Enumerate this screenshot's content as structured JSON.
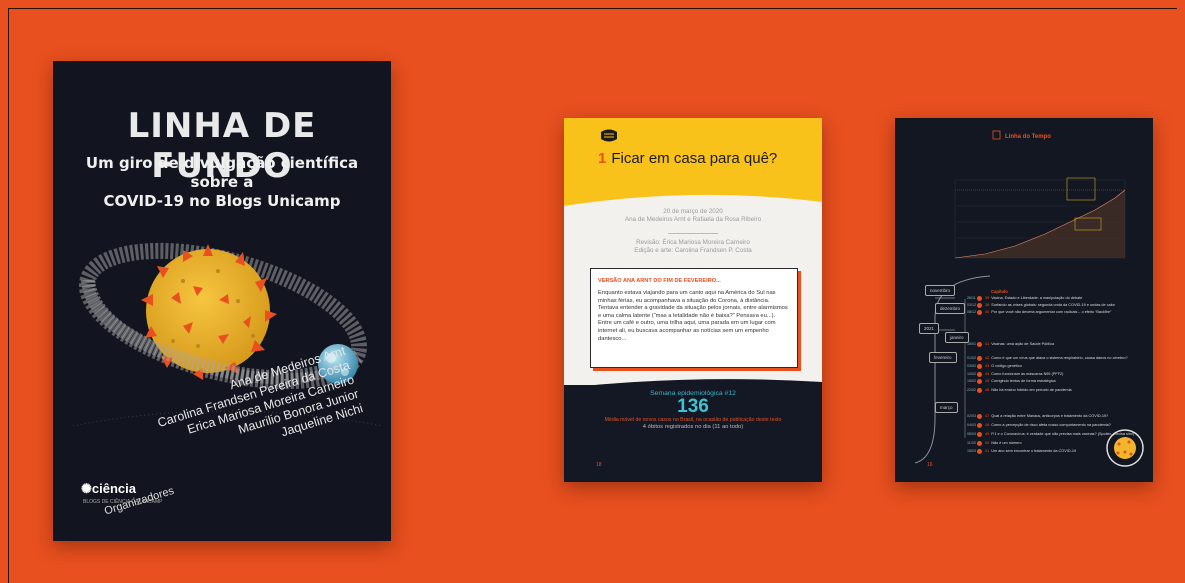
{
  "colors": {
    "background": "#e8501f",
    "cover_bg": "#12151f",
    "accent_yellow": "#f8c21b",
    "accent_cyan": "#3fc3d3"
  },
  "cover": {
    "title": "LINHA DE FUNDO",
    "subtitle_line1": "Um giro de divulgação científica sobre a",
    "subtitle_line2": "COVID-19 no Blogs Unicamp",
    "authors": [
      "Ana de Medeiros Arnt",
      "Carolina Frandsen Pereira da Costa",
      "Erica Mariosa Moreira Carneiro",
      "Maurilio Bonora Junior",
      "Jaqueline Nichi"
    ],
    "organizers_label": "Organizadores",
    "publisher_logo": "ciência",
    "publisher_sub": "BLOGS DE CIÊNCIA DA UNICAMP"
  },
  "page2": {
    "chapter_number": "1",
    "chapter_title": "Ficar em casa para quê?",
    "date": "20 de março de 2020",
    "authors": "Ana de Medeiros Arnt e Rafaela da Rosa Ribeiro",
    "review": "Revisão: Érica Mariosa Moreira Carneiro",
    "edition": "Edição e arte: Carolina Frandsen P. Costa",
    "box_title": "VERSÃO ANA ARNT DO FIM DE FEVEREIRO...",
    "box_text": "Enquanto estava viajando para um canto aqui na América do Sul nas minhas férias, eu acompanhava a situação do Corona, à distância. Tentava entender a gravidade da situação pelos jornais, entre alarmismos e uma calma latente (“mas a letalidade não é baixa?” Pensava eu...). Entre um café e outro, uma trilha aqui, uma parada em um lugar com internet ali, eu buscava acompanhar as notícias sem um empenho dantesco...",
    "week_label": "Semana epidemiológica #12",
    "big_number": "136",
    "avg_label": "Média móvel de novos casos no Brasil, na ocasião de publicação deste texto",
    "deaths_label": "4 óbitos registrados no dia (11 ao todo)",
    "page_number": "18"
  },
  "page3": {
    "title": "Linha do Tempo",
    "chapters_label": "Capítulo",
    "year_label": "2021",
    "months": [
      "novembro",
      "dezembro",
      "janeiro",
      "fevereiro",
      "março"
    ],
    "items": [
      {
        "date": "26/11",
        "num": "39",
        "text": "Vacina, Estado e Liberdade: a manipulação do debate"
      },
      {
        "date": "03/12",
        "num": "38",
        "text": "Surfando as crises globais: segunda onda da COVID-19 e ondas de calor"
      },
      {
        "date": "08/12",
        "num": "40",
        "text": "Por que você não deveria argumentar com radicais – o efeito “Backfire”"
      },
      {
        "date": "18/01",
        "num": "41",
        "text": "Vacinas: uma ação de Saúde Pública"
      },
      {
        "date": "01/02",
        "num": "42",
        "text": "Como é que um vírus que ataca o sistema respiratório, causa danos no cérebro?"
      },
      {
        "date": "03/02",
        "num": "43",
        "text": "O código genético"
      },
      {
        "date": "10/02",
        "num": "44",
        "text": "Como funcionam as máscaras N95 (PFF2)"
      },
      {
        "date": "15/02",
        "num": "45",
        "text": "Corrigindo textos de forma estratégica"
      },
      {
        "date": "22/02",
        "num": "46",
        "text": "Não há ensino híbrido em período de pandemia"
      },
      {
        "date": "02/03",
        "num": "47",
        "text": "Qual a relação entre Manaus, anticorpos e tratamento da COVID-19?"
      },
      {
        "date": "04/03",
        "num": "48",
        "text": "Como a percepção de risco afeta nosso comportamento na pandemia?"
      },
      {
        "date": "05/03",
        "num": "49",
        "text": "P.1 e o Coronavírus: é verdade que não precisa mais vacinas? (Spoiler, precisa sim!)"
      },
      {
        "date": "11/03",
        "num": "50",
        "text": "Não é um número"
      },
      {
        "date": "15/03",
        "num": "51",
        "text": "Um ano sem encontrar o tratamento da COVID-19"
      }
    ],
    "page_number": "16"
  }
}
